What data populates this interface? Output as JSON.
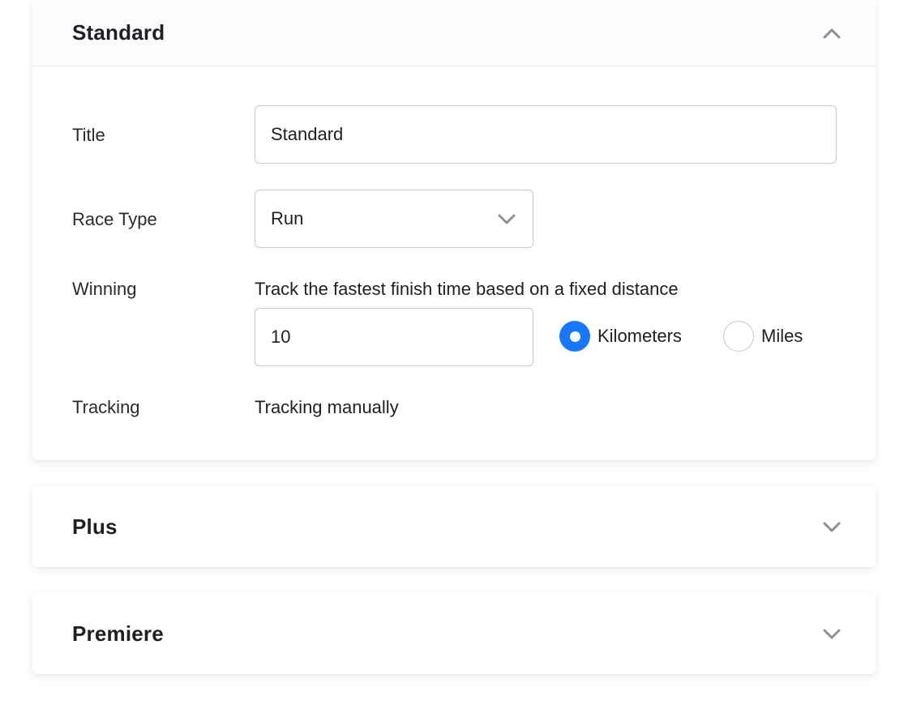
{
  "sections": {
    "standard": {
      "title": "Standard",
      "expanded": true,
      "fields": {
        "title_label": "Title",
        "title_value": "Standard",
        "race_type_label": "Race Type",
        "race_type_value": "Run",
        "winning_label": "Winning",
        "winning_help": "Track the fastest finish time based on a fixed distance",
        "distance_value": "10",
        "unit_options": [
          "Kilometers",
          "Miles"
        ],
        "unit_selected": "Kilometers",
        "tracking_label": "Tracking",
        "tracking_value": "Tracking manually"
      }
    },
    "plus": {
      "title": "Plus",
      "expanded": false
    },
    "premiere": {
      "title": "Premiere",
      "expanded": false
    }
  },
  "icons": {
    "standard_toggle": "chevron-up-icon",
    "race_type_select": "chevron-down-icon",
    "plus_toggle": "chevron-down-icon",
    "premiere_toggle": "chevron-down-icon"
  },
  "colors": {
    "accent": "#1677ff",
    "border": "#c8c8cc",
    "chevron": "#8e8e93",
    "text": "#1f1f24"
  }
}
